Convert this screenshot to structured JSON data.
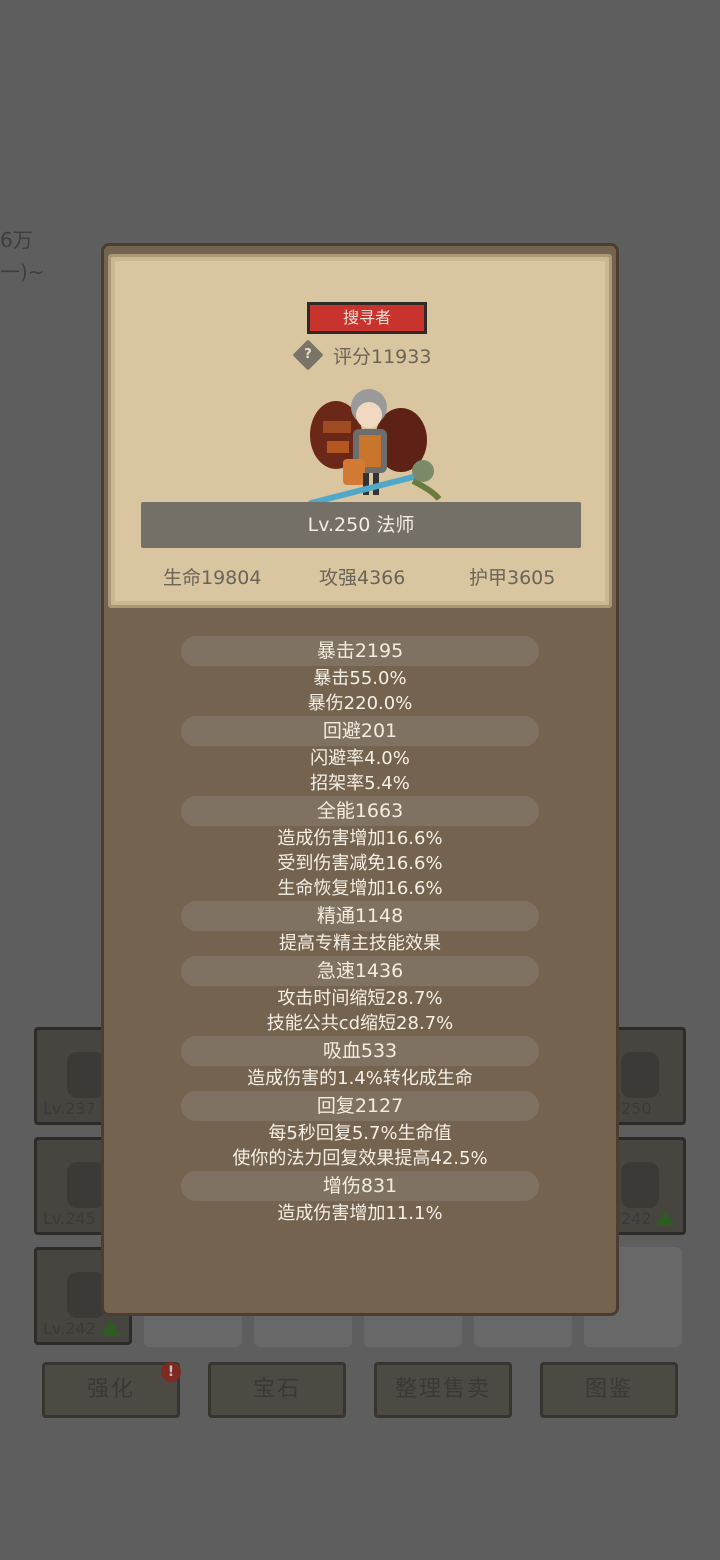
{
  "background": {
    "fragment_1": "6万",
    "fragment_2": "一)~",
    "slots": [
      {
        "level": "Lv.237",
        "upgrade": false
      },
      {
        "level": "Lv.245",
        "upgrade": false
      },
      {
        "level": "Lv.242",
        "upgrade": true
      },
      {
        "level": "250",
        "upgrade": false
      },
      {
        "level": "242",
        "upgrade": true
      }
    ],
    "buttons": [
      "强化",
      "宝石",
      "整理售卖",
      "图鉴"
    ],
    "badge": "!"
  },
  "popup": {
    "class_name": "搜寻者",
    "score": "评分11933",
    "help_icon": "?",
    "level_label": "Lv.250 法师",
    "stats": [
      "生命19804",
      "攻强4366",
      "护甲3605"
    ],
    "attribute_groups": [
      {
        "title": "暴击2195",
        "lines": [
          "暴击55.0%",
          "暴伤220.0%"
        ]
      },
      {
        "title": "回避201",
        "lines": [
          "闪避率4.0%",
          "招架率5.4%"
        ]
      },
      {
        "title": "全能1663",
        "lines": [
          "造成伤害增加16.6%",
          "受到伤害减免16.6%",
          "生命恢复增加16.6%"
        ]
      },
      {
        "title": "精通1148",
        "lines": [
          "提高专精主技能效果"
        ]
      },
      {
        "title": "急速1436",
        "lines": [
          "攻击时间缩短28.7%",
          "技能公共cd缩短28.7%"
        ]
      },
      {
        "title": "吸血533",
        "lines": [
          "造成伤害的1.4%转化成生命"
        ]
      },
      {
        "title": "回复2127",
        "lines": [
          "每5秒回复5.7%生命值",
          "使你的法力回复效果提高42.5%"
        ]
      },
      {
        "title": "增伤831",
        "lines": [
          "造成伤害增加11.1%"
        ]
      }
    ]
  }
}
